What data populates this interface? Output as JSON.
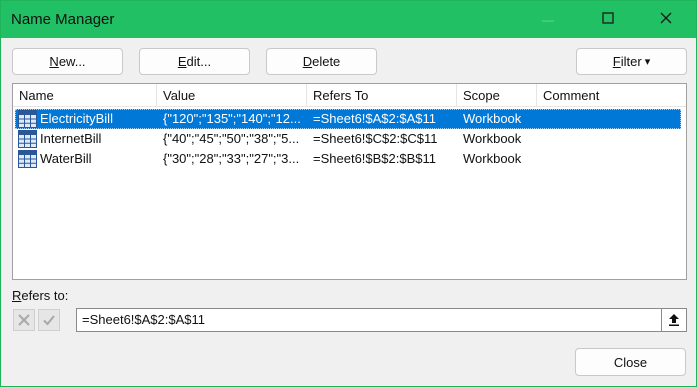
{
  "window": {
    "title": "Name Manager",
    "minimize_glyph": "—",
    "maximize_glyph": "□",
    "close_glyph": "✕"
  },
  "toolbar": {
    "new_accel": "N",
    "new_rest": "ew...",
    "edit_accel": "E",
    "edit_rest": "dit...",
    "delete_accel": "D",
    "delete_rest": "elete",
    "filter_accel": "F",
    "filter_rest": "ilter",
    "filter_caret": "▾"
  },
  "table": {
    "columns": [
      "Name",
      "Value",
      "Refers To",
      "Scope",
      "Comment"
    ],
    "rows": [
      {
        "name": "ElectricityBill",
        "value": "{\"120\";\"135\";\"140\";\"12...",
        "refers_to": "=Sheet6!$A$2:$A$11",
        "scope": "Workbook",
        "comment": "",
        "selected": true
      },
      {
        "name": "InternetBill",
        "value": "{\"40\";\"45\";\"50\";\"38\";\"5...",
        "refers_to": "=Sheet6!$C$2:$C$11",
        "scope": "Workbook",
        "comment": "",
        "selected": false
      },
      {
        "name": "WaterBill",
        "value": "{\"30\";\"28\";\"33\";\"27\";\"3...",
        "refers_to": "=Sheet6!$B$2:$B$11",
        "scope": "Workbook",
        "comment": "",
        "selected": false
      }
    ]
  },
  "refers": {
    "label_accel": "R",
    "label_rest": "efers to:",
    "value": "=Sheet6!$A$2:$A$11"
  },
  "footer": {
    "close_label": "Close"
  },
  "colors": {
    "titlebar": "#21c064",
    "selection": "#0078d7",
    "dialog_bg": "#f0f0f0"
  },
  "icons": [
    "minimize-icon",
    "maximize-icon",
    "close-icon",
    "dropdown-caret-icon",
    "name-table-icon",
    "cancel-x-icon",
    "confirm-check-icon",
    "collapse-dialog-icon"
  ]
}
